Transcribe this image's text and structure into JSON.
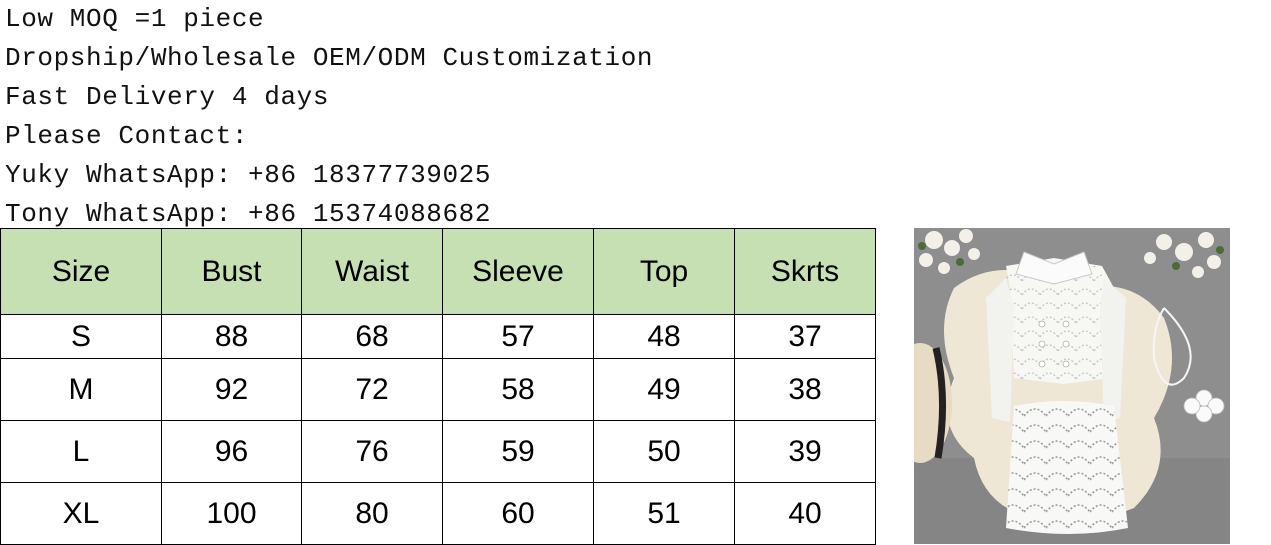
{
  "notes": [
    "Low MOQ =1 piece",
    "Dropship/Wholesale OEM/ODM Customization",
    "Fast Delivery 4 days",
    "Please Contact:",
    "Yuky WhatsApp: +86 18377739025",
    "Tony WhatsApp: +86 15374088682"
  ],
  "size_table": {
    "headers": [
      "Size",
      "Bust",
      "Waist",
      "Sleeve",
      "Top",
      "Skrts"
    ],
    "rows": [
      [
        "S",
        "88",
        "68",
        "57",
        "48",
        "37"
      ],
      [
        "M",
        "92",
        "72",
        "58",
        "49",
        "38"
      ],
      [
        "L",
        "96",
        "76",
        "59",
        "50",
        "39"
      ],
      [
        "XL",
        "100",
        "80",
        "60",
        "51",
        "40"
      ]
    ],
    "header_color": "#c6e0b4"
  }
}
